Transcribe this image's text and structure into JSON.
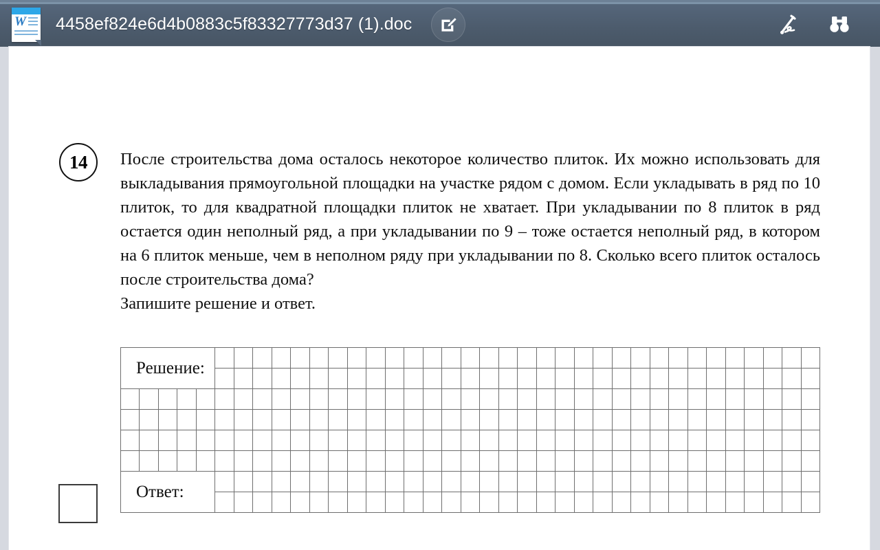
{
  "toolbar": {
    "app_icon": "word-document-icon",
    "document_title": "4458ef824e6d4b0883c5f83327773d37 (1).doc",
    "edit_button_icon": "edit-pencil-square-icon",
    "sign_button_icon": "signature-pen-icon",
    "find_button_icon": "binoculars-icon",
    "background_color": "#4c5b6c",
    "text_color": "#ffffff"
  },
  "document": {
    "task_number": "14",
    "task_text": "После строительства дома осталось некоторое количество плиток. Их можно использовать для выкладывания прямоугольной площадки на участке рядом с домом. Если укладывать в ряд по 10 плиток, то для квадратной площадки плиток не хватает. При укладывании по 8 плиток в ряд остается один неполный ряд, а при укладывании по 9 – тоже остается неполный ряд, в котором на 6 плиток меньше, чем в неполном ряду при укладывании по 8. Сколько всего плиток осталось после строительства дома?",
    "task_instruction": "Запишите решение и ответ.",
    "grid": {
      "solution_label": "Решение:",
      "answer_label": "Ответ:",
      "total_columns": 37,
      "total_rows": 8,
      "label_colspan": 5,
      "label_rowspan": 2,
      "solution_rows_after_label": 4,
      "cell_size_px": 27.5
    },
    "score_box": "empty-score-box",
    "page_background": "#ffffff",
    "page_surround_color": "#d6d9e0"
  }
}
